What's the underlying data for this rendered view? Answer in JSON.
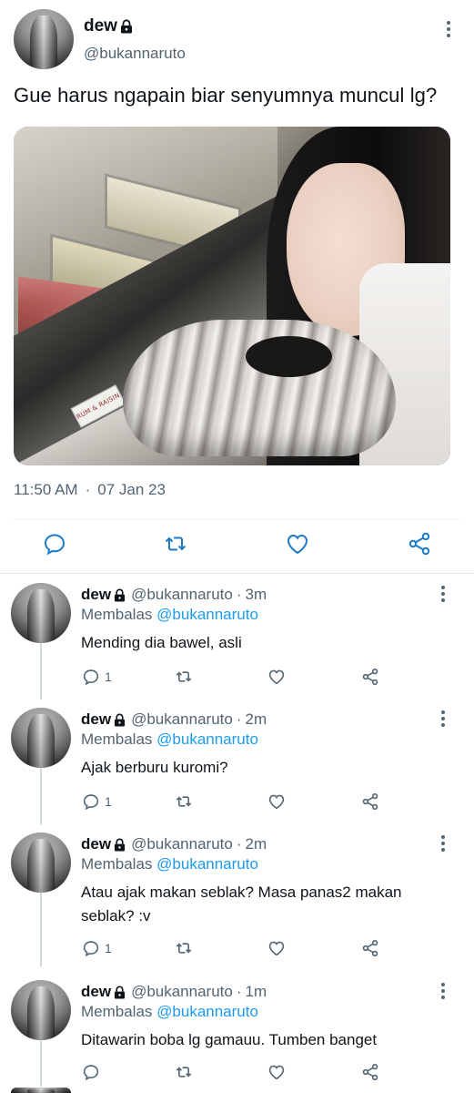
{
  "main_tweet": {
    "name": "dew",
    "handle": "@bukannaruto",
    "text": "Gue harus ngapain biar senyumnya muncul lg?",
    "photo_sign": "RUM & RAISIN",
    "time": "11:50 AM",
    "separator": "·",
    "date": "07 Jan 23"
  },
  "icons": {
    "lock": "lock-icon",
    "more": "more-vertical-icon",
    "reply": "reply-icon",
    "retweet": "retweet-icon",
    "like": "heart-icon",
    "share": "share-icon"
  },
  "colors": {
    "text": "#0f1419",
    "secondary": "#536471",
    "link": "#1d9bf0"
  },
  "replies": [
    {
      "name": "dew",
      "handle": "@bukannaruto",
      "separator": "·",
      "time": "3m",
      "replying_label": "Membalas",
      "replying_to": "@bukannaruto",
      "text": "Mending dia bawel, asli",
      "reply_count": "1"
    },
    {
      "name": "dew",
      "handle": "@bukannaruto",
      "separator": "·",
      "time": "2m",
      "replying_label": "Membalas",
      "replying_to": "@bukannaruto",
      "text": "Ajak berburu kuromi?",
      "reply_count": "1"
    },
    {
      "name": "dew",
      "handle": "@bukannaruto",
      "separator": "·",
      "time": "2m",
      "replying_label": "Membalas",
      "replying_to": "@bukannaruto",
      "text": "Atau ajak makan seblak? Masa panas2 makan seblak? :v",
      "reply_count": "1"
    },
    {
      "name": "dew",
      "handle": "@bukannaruto",
      "separator": "·",
      "time": "1m",
      "replying_label": "Membalas",
      "replying_to": "@bukannaruto",
      "text": "Ditawarin boba lg gamauu. Tumben banget",
      "reply_count": ""
    }
  ]
}
